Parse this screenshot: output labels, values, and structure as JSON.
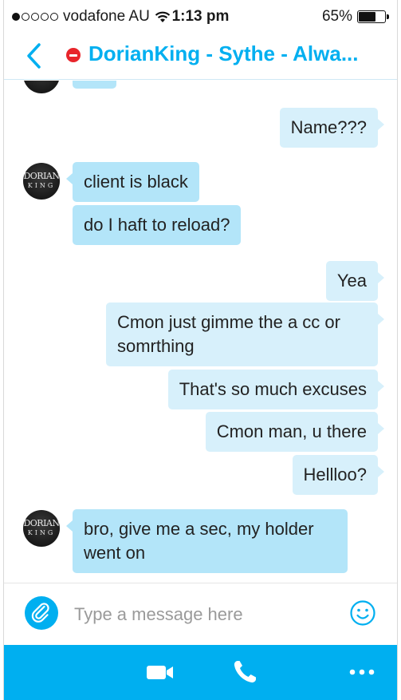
{
  "status_bar": {
    "carrier": "vodafone AU",
    "time": "1:13 pm",
    "battery": "65%",
    "battery_level": 0.65,
    "signal_dots_filled": 1,
    "signal_dots_total": 5
  },
  "header": {
    "title": "DorianKing - Sythe - Alwa...",
    "presence": "do-not-disturb",
    "presence_color": "#e8252b",
    "accent_color": "#00aff0"
  },
  "avatar": {
    "line1": "DORIAN",
    "line2": "KING"
  },
  "messages": [
    {
      "direction": "out",
      "text": "Name???"
    },
    {
      "direction": "in",
      "text": "client is black"
    },
    {
      "direction": "in",
      "text": "do I haft to reload?"
    },
    {
      "direction": "out",
      "text": "Yea"
    },
    {
      "direction": "out",
      "text": "Cmon just gimme the a cc or somrthing"
    },
    {
      "direction": "out",
      "text": "That's so much excuses"
    },
    {
      "direction": "out",
      "text": "Cmon man, u there"
    },
    {
      "direction": "out",
      "text": "Hellloo?"
    },
    {
      "direction": "in",
      "text": "bro, give me a sec, my holder went on"
    }
  ],
  "composer": {
    "placeholder": "Type a message here",
    "attach_icon": "paperclip-icon",
    "emoji_icon": "smiley-icon"
  },
  "bottom_bar": {
    "icons": [
      "video-call-icon",
      "phone-icon",
      "more-icon"
    ],
    "background": "#00aff0"
  }
}
